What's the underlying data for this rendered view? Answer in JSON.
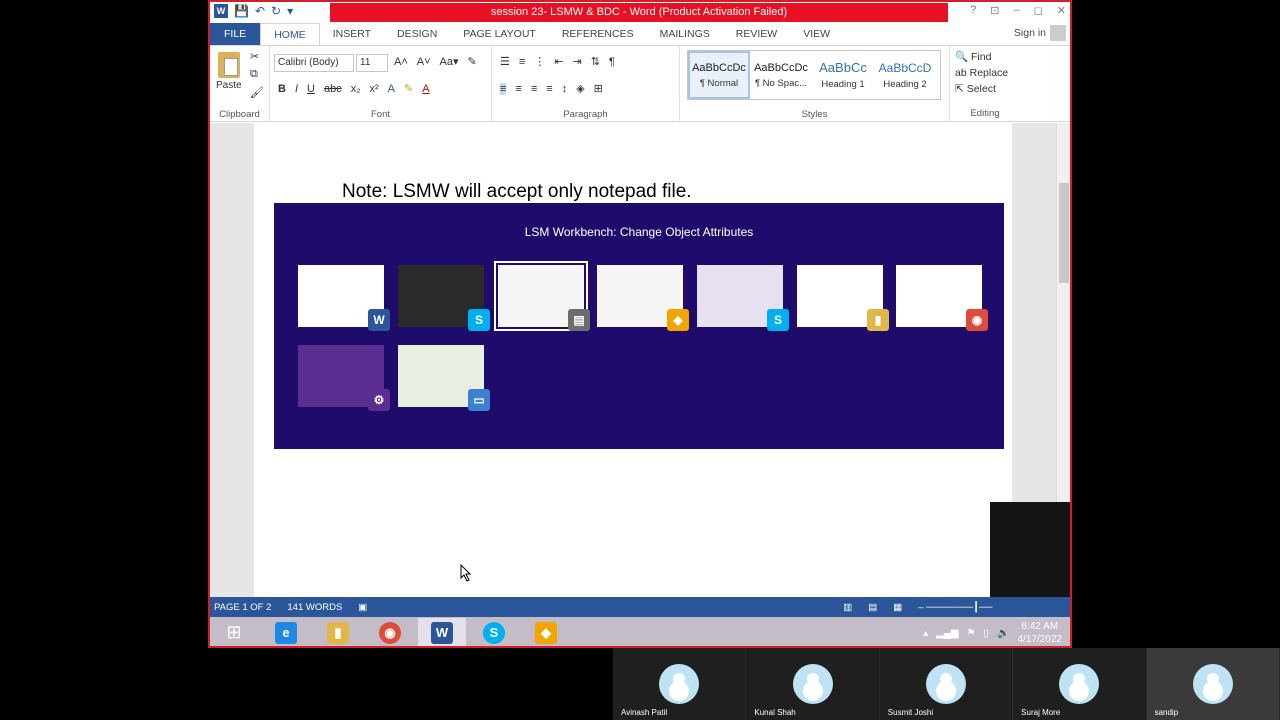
{
  "window": {
    "title": "session 23- LSMW & BDC -  Word (Product Activation Failed)",
    "help": "?",
    "controls": [
      "⊡",
      "–",
      "◻",
      "✕"
    ]
  },
  "tabs": [
    {
      "label": "FILE"
    },
    {
      "label": "HOME"
    },
    {
      "label": "INSERT"
    },
    {
      "label": "DESIGN"
    },
    {
      "label": "PAGE LAYOUT"
    },
    {
      "label": "REFERENCES"
    },
    {
      "label": "MAILINGS"
    },
    {
      "label": "REVIEW"
    },
    {
      "label": "VIEW"
    }
  ],
  "signin": "Sign in",
  "ribbon": {
    "clipboard": {
      "paste": "Paste",
      "label": "Clipboard"
    },
    "font": {
      "name": "Calibri (Body)",
      "size": "11",
      "label": "Font"
    },
    "paragraph": {
      "label": "Paragraph"
    },
    "styles": {
      "label": "Styles",
      "items": [
        {
          "sample": "AaBbCcDc",
          "name": "¶ Normal"
        },
        {
          "sample": "AaBbCcDc",
          "name": "¶ No Spac..."
        },
        {
          "sample": "AaBbCc",
          "name": "Heading 1"
        },
        {
          "sample": "AaBbCcD",
          "name": "Heading 2"
        }
      ]
    },
    "editing": {
      "find": "Find",
      "replace": "Replace",
      "select": "Select",
      "label": "Editing"
    }
  },
  "document": {
    "note": "Note: LSMW will accept only notepad file."
  },
  "switcher": {
    "title": "LSM Workbench: Change Object Attributes",
    "items": [
      {
        "name": "word-window",
        "badge": "W",
        "color": "#2b579a"
      },
      {
        "name": "skype-call",
        "badge": "S",
        "color": "#00aff0"
      },
      {
        "name": "lsmw-window",
        "badge": "▤",
        "color": "#6d6d6d"
      },
      {
        "name": "sap-window",
        "badge": "◆",
        "color": "#f0a500"
      },
      {
        "name": "skype-window",
        "badge": "S",
        "color": "#00aff0"
      },
      {
        "name": "explorer-window",
        "badge": "▮",
        "color": "#e0b84a"
      },
      {
        "name": "chrome-window",
        "badge": "◉",
        "color": "#dd4b39"
      },
      {
        "name": "settings-window",
        "badge": "⚙",
        "color": "#5c2d91"
      },
      {
        "name": "desktop",
        "badge": "▭",
        "color": "#3d7fd1"
      }
    ]
  },
  "status": {
    "page": "PAGE 1 OF 2",
    "words": "141 WORDS"
  },
  "taskbar": {
    "time": "6:42 AM",
    "date": "4/17/2022"
  },
  "participants": [
    {
      "name": "Avinash Patil"
    },
    {
      "name": "Kunal Shah"
    },
    {
      "name": "Susmit Joshi"
    },
    {
      "name": "Suraj More"
    },
    {
      "name": "sandip"
    }
  ]
}
